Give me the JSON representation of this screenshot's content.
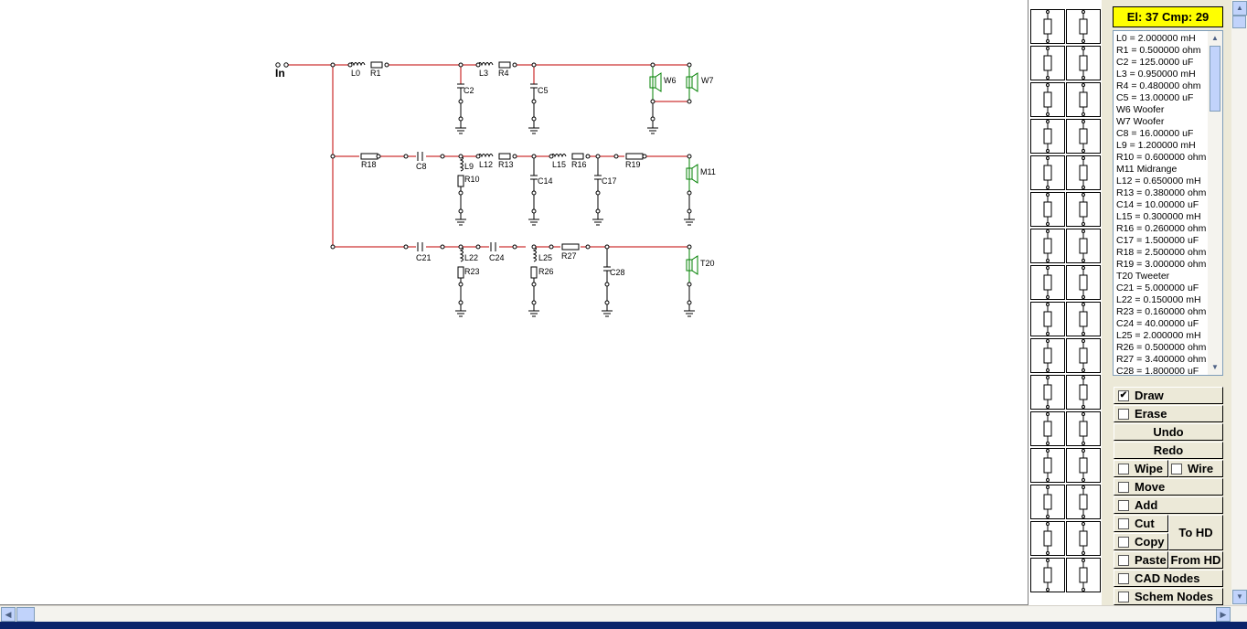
{
  "status": {
    "counter": "El: 37 Cmp: 29"
  },
  "components": [
    "L0 = 2.000000 mH",
    "R1 = 0.500000 ohm",
    "C2 = 125.0000 uF",
    "L3 = 0.950000 mH",
    "R4 = 0.480000 ohm",
    "C5 = 13.00000 uF",
    "W6 Woofer",
    "W7 Woofer",
    "C8 = 16.00000 uF",
    "L9 = 1.200000 mH",
    "R10 = 0.600000 ohm",
    "M11 Midrange",
    "L12 = 0.650000 mH",
    "R13 = 0.380000 ohm",
    "C14 = 10.00000 uF",
    "L15 = 0.300000 mH",
    "R16 = 0.260000 ohm",
    "C17 = 1.500000 uF",
    "R18 = 2.500000 ohm",
    "R19 = 3.000000 ohm",
    "T20 Tweeter",
    "C21 = 5.000000 uF",
    "L22 = 0.150000 mH",
    "R23 = 0.160000 ohm",
    "C24 = 40.00000 uF",
    "L25 = 2.000000 mH",
    "R26 = 0.500000 ohm",
    "R27 = 3.400000 ohm",
    "C28 = 1.800000 uF"
  ],
  "toolbar": {
    "draw": "Draw",
    "draw_checked": "✔",
    "erase": "Erase",
    "undo": "Undo",
    "redo": "Redo",
    "wipe": "Wipe",
    "wire": "Wire",
    "move": "Move",
    "add": "Add",
    "cut": "Cut",
    "copy": "Copy",
    "paste": "Paste",
    "to_hd": "To HD",
    "from_hd": "From HD",
    "cad_nodes": "CAD Nodes",
    "schem_nodes": "Schem Nodes"
  },
  "schematic": {
    "input_label": "In",
    "labels": [
      "L0",
      "R1",
      "C2",
      "L3",
      "R4",
      "C5",
      "W6",
      "W7",
      "R18",
      "C8",
      "L9",
      "R10",
      "L12",
      "R13",
      "C14",
      "L15",
      "R16",
      "C17",
      "R19",
      "M11",
      "C21",
      "L22",
      "R23",
      "C24",
      "L25",
      "R26",
      "R27",
      "C28",
      "T20"
    ]
  },
  "palette": {
    "left": [
      "speaker-icon",
      "input-terminal-icon",
      "variable-resistor-icon",
      "node-icon",
      "ground-icon",
      "switch-icon",
      "amplifier-icon",
      "op-amp-plus-icon",
      "series-rc-icon",
      "rl-parallel-icon",
      "inductor-parallel-icon",
      "capacitor-tee-icon",
      "terminal-capacitor-icon",
      "transformer-t-icon",
      "op-amp-diff-icon",
      "op-amp-invert-icon"
    ],
    "right": [
      "resistor-vertical-icon",
      "resistor-horizontal-icon",
      "capacitor-vertical-icon",
      "capacitor-horizontal-icon",
      "inductor-vertical-icon",
      "inductor-horizontal-icon",
      "rl-series-vertical-icon",
      "resistor-box-icon",
      "inductor-resistor-h-icon",
      "resistor-capacitor-box-icon",
      "inductor-resistor-v-icon",
      "transformer-box-icon",
      "tank-circuit-icon",
      "transformer-f-icon",
      "op-amp-diff2-icon",
      "op-amp-invert2-icon"
    ]
  },
  "colors": {
    "wire": "#c00000",
    "component": "#000000",
    "driver": "#008000",
    "counter_bg": "#ffff00"
  }
}
